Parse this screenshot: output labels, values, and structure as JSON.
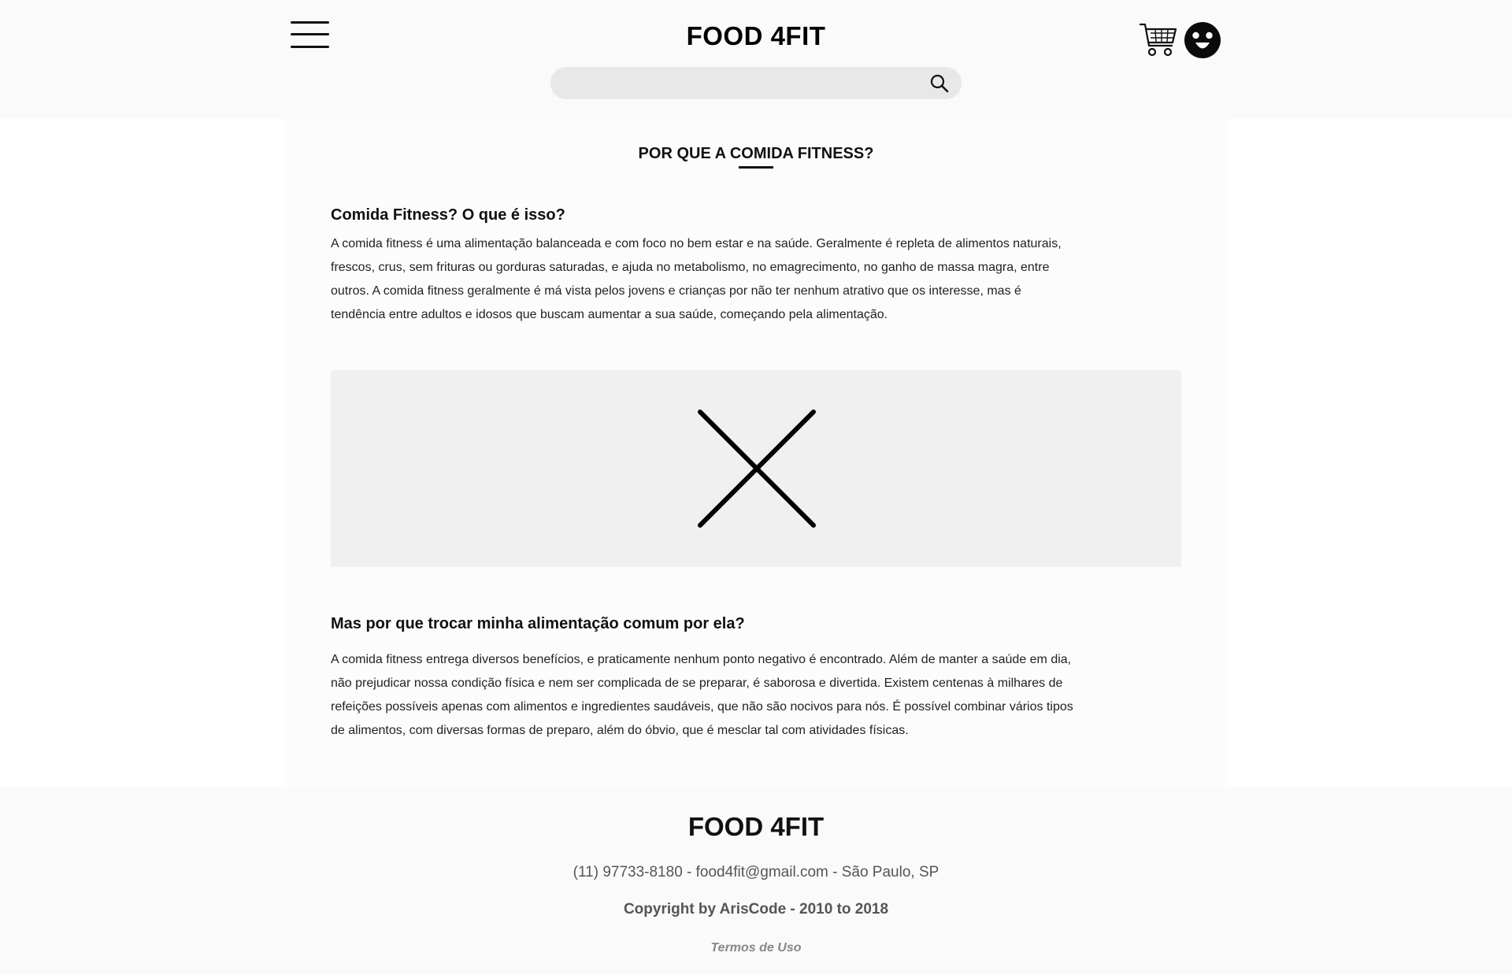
{
  "header": {
    "brand": "FOOD 4FIT",
    "search": {
      "value": "",
      "placeholder": ""
    },
    "icons": {
      "menu": "hamburger-menu-icon",
      "cart": "shopping-cart-icon",
      "avatar": "user-avatar-icon",
      "search": "magnifier-icon"
    }
  },
  "main": {
    "title": "POR QUE A COMIDA FITNESS?",
    "sections": [
      {
        "heading": "Comida Fitness? O que é isso?",
        "body": "A comida fitness é uma alimentação balanceada e com foco no bem estar e na saúde. Geralmente é repleta de alimentos naturais, frescos, crus, sem frituras ou gorduras saturadas, e ajuda no metabolismo, no emagrecimento, no ganho de massa magra, entre outros. A comida fitness geralmente é má vista pelos jovens e crianças por não ter nenhum atrativo que os interesse, mas é tendência entre adultos e idosos que buscam aumentar a sua saúde, começando pela alimentação."
      },
      {
        "heading": "Mas por que trocar minha alimentação comum por ela?",
        "body": "A comida fitness entrega diversos benefícios, e praticamente nenhum ponto negativo é encontrado. Além de manter a saúde em dia, não prejudicar nossa condição física e nem ser complicada de se preparar, é saborosa e divertida. Existem centenas à milhares de refeições possíveis apenas com alimentos e ingredientes saudáveis, que não são nocivos para nós. É possível combinar vários tipos de alimentos, com diversas formas de preparo, além do óbvio, que é mesclar tal com atividades físicas."
      }
    ],
    "image_placeholder_icon": "close-x-icon"
  },
  "footer": {
    "brand": "FOOD 4FIT",
    "contact": "(11) 97733-8180 - food4fit@gmail.com - São Paulo, SP",
    "copyright": "Copyright by ArisCode - 2010 to 2018",
    "terms": "Termos de Uso"
  },
  "colors": {
    "header_bg": "#fafafa",
    "main_bg": "#fcfcfc",
    "search_bg": "#e8e8e8",
    "placeholder_bg": "#f0f0f0",
    "text": "#111111",
    "muted_text": "#555555"
  }
}
